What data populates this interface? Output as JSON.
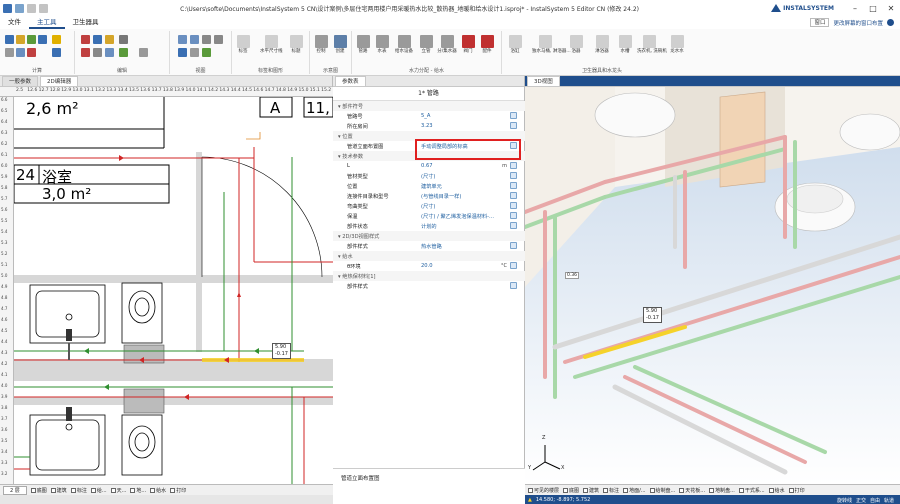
{
  "titlebar": {
    "title": "C:\\Users\\softe\\Documents\\InstalSystem 5 CN\\设计案例\\多层住宅两用楼户用采暖热水比较_散热器_地暖和给水设计1.isproj* - InstalSystem 5 Editor CN (修改 24.2)",
    "brand": "INSTALSYSTEM",
    "win_min": "–",
    "win_max": "□",
    "win_close": "✕"
  },
  "menu": {
    "items": [
      "文件",
      "主工具",
      "卫生器具"
    ],
    "window_label": "窗口",
    "window_sel": "更改屏幕的窗口布置"
  },
  "ribbon": {
    "groups": [
      "计算",
      "编辑",
      "视图",
      "标签和图形",
      "示意图",
      "水力分配 - 给水",
      "卫生器具和水龙头"
    ],
    "labels_views": [
      "标签",
      "水平尺寸线",
      "标题"
    ],
    "labels_schema": [
      "控制",
      "创建"
    ],
    "labels_hydraulic": [
      "管路",
      "水表",
      "给水设备",
      "立管",
      "分/集水器",
      "阀门",
      "配件"
    ],
    "labels_fixtures": [
      "浴缸",
      "独水马桶,\n淋浴器...",
      "浴器",
      "淋浴器",
      "水槽",
      "洗衣机,\n洗碗机",
      "龙水水"
    ]
  },
  "left_panel": {
    "tab1": "一般参数",
    "tab2": "2D编辑器",
    "ruler_h": [
      "2.5",
      "12.6",
      "12.7",
      "12.8",
      "12.9",
      "13.0",
      "13.1",
      "13.2",
      "13.3",
      "13.4",
      "13.5",
      "13.6",
      "13.7",
      "13.8",
      "13.9",
      "14.0",
      "14.1",
      "14.2",
      "14.3",
      "14.4",
      "14.5",
      "14.6",
      "14.7",
      "14.8",
      "14.9",
      "15.0",
      "15.1",
      "15.2"
    ],
    "ruler_v": [
      "6.6",
      "6.5",
      "6.4",
      "6.3",
      "6.2",
      "6.1",
      "6.0",
      "5.9",
      "5.8",
      "5.7",
      "5.6",
      "5.5",
      "5.4",
      "5.3",
      "5.2",
      "5.1",
      "5.0",
      "4.9",
      "4.8",
      "4.7",
      "4.6",
      "4.5",
      "4.4",
      "4.3",
      "4.2",
      "4.1",
      "4.0",
      "3.9",
      "3.8",
      "3.7",
      "3.6",
      "3.5",
      "3.4",
      "3.3",
      "3.2"
    ],
    "room1_area": "2,6 m²",
    "room_letter": "A",
    "room_num": "11,",
    "room2_num": "24",
    "room2_name": "浴室",
    "room2_area": "3,0 m²",
    "tag1": "5.90",
    "tag2": "-0.17",
    "floor_label": "2 层",
    "status_items": [
      "底图",
      "建筑",
      "标注",
      "给...",
      "天...",
      "地...",
      "给水",
      "打印"
    ]
  },
  "props": {
    "panel_tab": "参数表",
    "title": "1* 管路",
    "rows": [
      {
        "type": "section",
        "label": "部件符号"
      },
      {
        "label": "管路号",
        "value": "5_A"
      },
      {
        "label": "所在房间",
        "value": "3.23"
      },
      {
        "type": "section",
        "label": "位置"
      },
      {
        "label": "管道立面布置图",
        "value": "手动调整局部的标高"
      },
      {
        "type": "section",
        "label": "技术参数"
      },
      {
        "label": "L",
        "value": "0.67",
        "unit": "m"
      },
      {
        "label": "管材类型",
        "value": "(尺寸)"
      },
      {
        "label": "位置",
        "value": "建筑单元"
      },
      {
        "label": "连接件目录和型号",
        "value": "(与管线目录一样)"
      },
      {
        "label": "弯曲类型",
        "value": "(尺寸)"
      },
      {
        "label": "保温",
        "value": "(尺寸) / 聚乙烯发泡保温材料-..."
      },
      {
        "label": "部件状态",
        "value": "计划的"
      },
      {
        "type": "section",
        "label": "2D/3D视图样式"
      },
      {
        "label": "部件样式",
        "value": "热水管路"
      },
      {
        "type": "section",
        "label": "给水"
      },
      {
        "label": "θ环境",
        "value": "20.0",
        "unit": "°C"
      },
      {
        "type": "section",
        "label": "绝热保材料[1]"
      },
      {
        "label": "部件样式",
        "value": ""
      }
    ],
    "bottom_label": "管道立面布置图"
  },
  "view3d": {
    "tab": "3D视图",
    "tag1": "5.90",
    "tag2": "-0.17",
    "label_left": "0.36",
    "axis_x": "X",
    "axis_y": "Y",
    "axis_z": "Z",
    "status_items": [
      "可见的楼层",
      "底图",
      "建筑",
      "标注",
      "地面/...",
      "给制盘...",
      "天花板...",
      "地制盘...",
      "干式系...",
      "给水",
      "打印"
    ],
    "coords": "14.580; -8.897; 5.752",
    "mode1": "旋转线",
    "mode2": "正交",
    "mode3": "自由",
    "mode4": "轨道"
  },
  "colors": {
    "accent": "#1f4e8c",
    "highlight_border": "#e02020",
    "pipe_green": "#2f8f2f",
    "pipe_red": "#d02525",
    "pipe_yellow": "#f5d22a"
  }
}
